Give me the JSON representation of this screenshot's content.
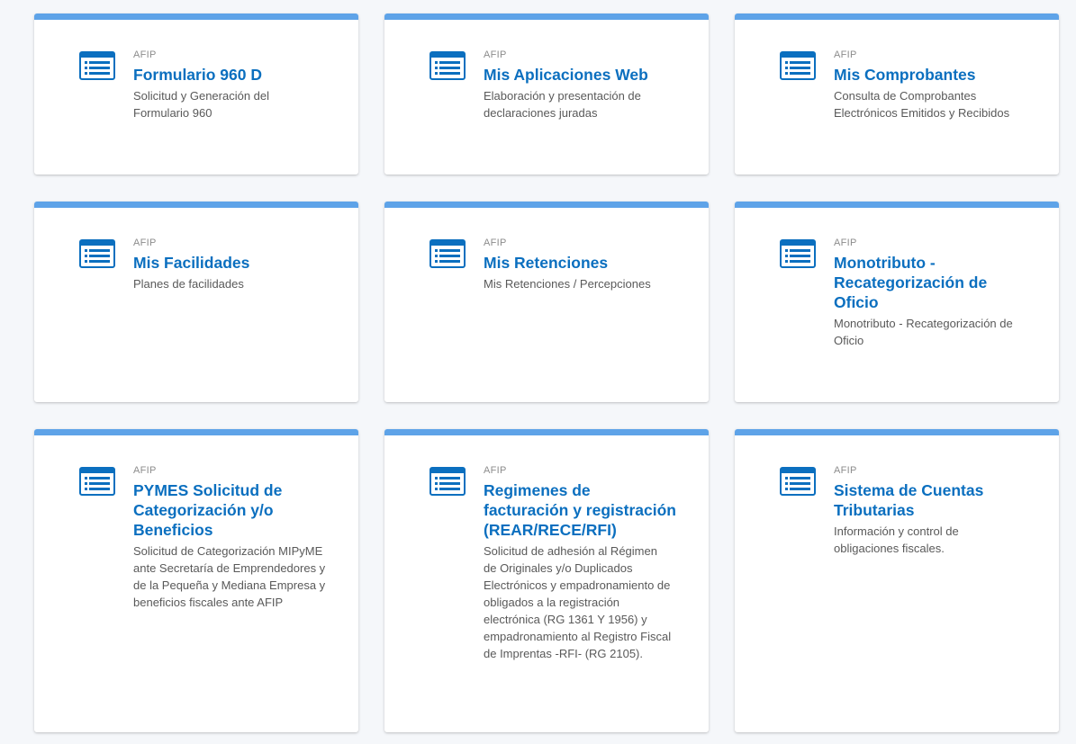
{
  "colors": {
    "accent_bar": "#5ea3e8",
    "title": "#0b6fbf",
    "icon": "#0b6fbf",
    "background": "#f5f7fa"
  },
  "icon_name": "list-document-icon",
  "cards": [
    {
      "org": "AFIP",
      "title": "Formulario 960 D",
      "description": "Solicitud y Generación del Formulario 960"
    },
    {
      "org": "AFIP",
      "title": "Mis Aplicaciones Web",
      "description": "Elaboración y presentación de declaraciones juradas"
    },
    {
      "org": "AFIP",
      "title": "Mis Comprobantes",
      "description": "Consulta de Comprobantes Electrónicos Emitidos y Recibidos"
    },
    {
      "org": "AFIP",
      "title": "Mis Facilidades",
      "description": "Planes de facilidades"
    },
    {
      "org": "AFIP",
      "title": "Mis Retenciones",
      "description": "Mis Retenciones / Percepciones"
    },
    {
      "org": "AFIP",
      "title": "Monotributo - Recategorización de Oficio",
      "description": "Monotributo - Recategorización de Oficio"
    },
    {
      "org": "AFIP",
      "title": "PYMES Solicitud de Categorización y/o Beneficios",
      "description": "Solicitud de Categorización MIPyME ante Secretaría de Emprendedores y de la Pequeña y Mediana Empresa y beneficios fiscales ante AFIP"
    },
    {
      "org": "AFIP",
      "title": "Regimenes de facturación y registración (REAR/RECE/RFI)",
      "description": "Solicitud de adhesión al Régimen de Originales y/o Duplicados Electrónicos y empadronamiento de obligados a la registración electrónica (RG 1361 Y 1956) y empadronamiento al Registro Fiscal de Imprentas -RFI- (RG 2105)."
    },
    {
      "org": "AFIP",
      "title": "Sistema de Cuentas Tributarias",
      "description": "Información y control de obligaciones fiscales."
    }
  ]
}
